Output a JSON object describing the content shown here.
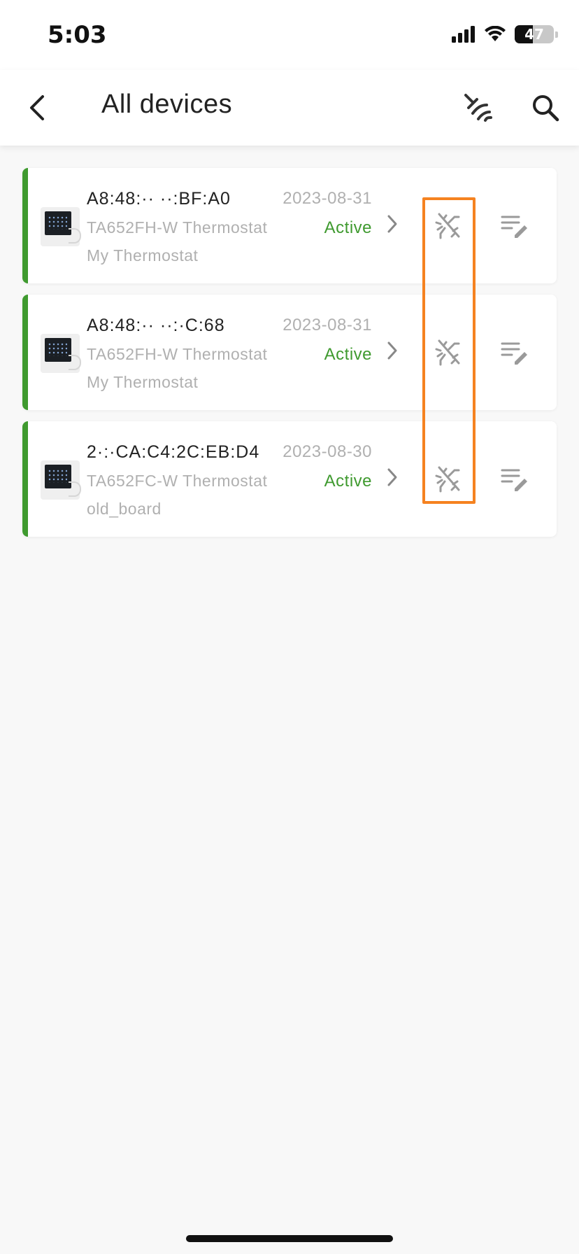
{
  "status_bar": {
    "time": "5:03",
    "battery": "47",
    "battery_level": 0.47
  },
  "header": {
    "title": "All devices"
  },
  "devices": [
    {
      "mac": "A8:48:·· ··:BF:A0",
      "date": "2023-08-31",
      "model": "TA652FH-W Thermostat",
      "status": "Active",
      "name": "My Thermostat"
    },
    {
      "mac": "A8:48:·· ··:·C:68",
      "date": "2023-08-31",
      "model": "TA652FH-W Thermostat",
      "status": "Active",
      "name": "My Thermostat"
    },
    {
      "mac": "2·:·CA:C4:2C:EB:D4",
      "date": "2023-08-30",
      "model": "TA652FC-W Thermostat",
      "status": "Active",
      "name": "old_board"
    }
  ],
  "colors": {
    "accent": "#3f9a2f",
    "highlight": "#f58220",
    "muted": "#b0b0b0"
  }
}
